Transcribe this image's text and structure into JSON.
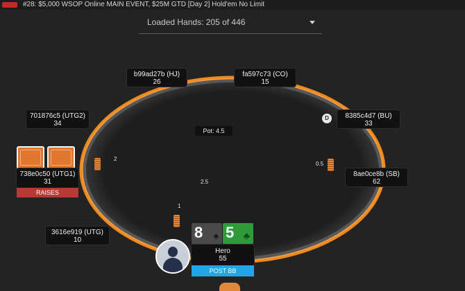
{
  "window": {
    "title": "#28: $5,000 WSOP Online MAIN EVENT, $25M GTD [Day 2] Hold'em No Limit"
  },
  "hands_select": {
    "label": "Loaded Hands: 205 of 446"
  },
  "pot": {
    "label": "Pot: 4.5"
  },
  "seats": [
    {
      "id": "hj",
      "name": "b99ad27b (HJ)",
      "stack": "26"
    },
    {
      "id": "co",
      "name": "fa597c73 (CO)",
      "stack": "15"
    },
    {
      "id": "utg2",
      "name": "701876c5 (UTG2)",
      "stack": "34"
    },
    {
      "id": "bu",
      "name": "8385c4d7 (BU)",
      "stack": "33"
    },
    {
      "id": "utg1",
      "name": "738e0c50 (UTG1)",
      "stack": "31",
      "action": "RAISES"
    },
    {
      "id": "sb",
      "name": "8ae0ce8b (SB)",
      "stack": "62"
    },
    {
      "id": "utg",
      "name": "3616e919 (UTG)",
      "stack": "10"
    },
    {
      "id": "hero",
      "name": "Hero",
      "stack": "55",
      "action": "POST BB"
    }
  ],
  "bets": {
    "utg1": "2",
    "sb": "0.5",
    "center": "2.5",
    "hero": "1"
  },
  "dealer_button": {
    "label": "D"
  },
  "hero_cards": [
    {
      "rank": "8",
      "suit": "spade",
      "suit_glyph": "♠",
      "color": "#4a4a4a"
    },
    {
      "rank": "5",
      "suit": "club",
      "suit_glyph": "♣",
      "color": "#2e9a3a"
    }
  ],
  "colors": {
    "table_rail": "#f08a1d",
    "felt": "#1e1e1e",
    "raise": "#b53a33",
    "post": "#1da7e8"
  }
}
